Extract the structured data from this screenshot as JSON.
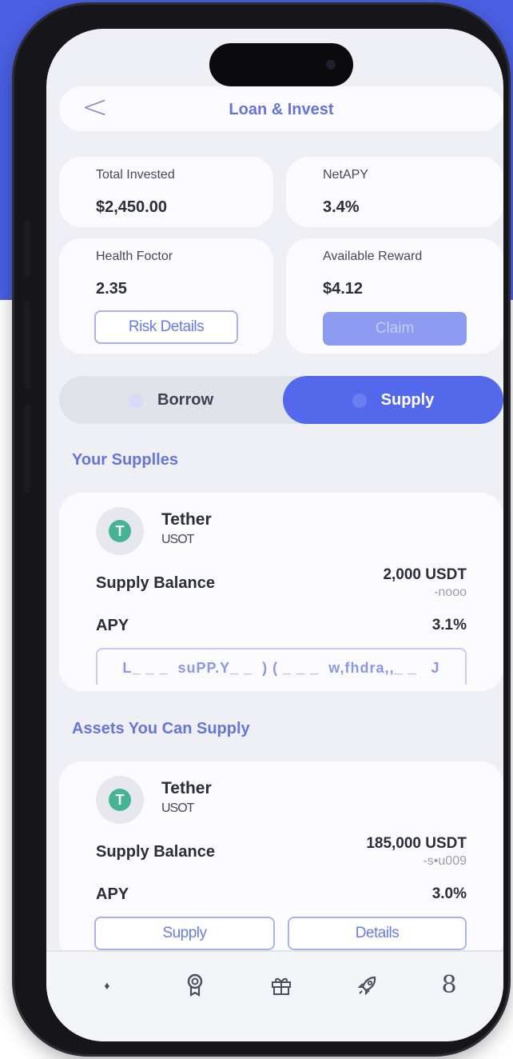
{
  "header": {
    "back_icon": "chevron-left-icon",
    "title": "Loan & Invest"
  },
  "stats": {
    "total_invested": {
      "label": "Total Invested",
      "value": "$2,450.00"
    },
    "net_apy": {
      "label": "NetAPY",
      "value": "3.4%"
    },
    "health_factor": {
      "label": "Health Foctor",
      "value": "2.35",
      "button": "Risk Details"
    },
    "available_reward": {
      "label": "Available Reward",
      "value": "$4.12",
      "button": "Claim"
    }
  },
  "segment": {
    "borrow": "Borrow",
    "supply": "Supply",
    "active": "Supply"
  },
  "your_supplies": {
    "title": "Your Supplles",
    "asset": {
      "name": "Tether",
      "symbol": "USOT",
      "balance_label": "Supply Balance",
      "balance_value": "2,000 USDT",
      "balance_sub": "-nooo",
      "apy_label": "APY",
      "apy_value": "3.1%",
      "actions_text": "L_ _ _  suPP.Y_ _  ) ( _ _ _  w,fhdra,,_ _   J"
    }
  },
  "assets_can_supply": {
    "title": "Assets You Can Supply",
    "asset": {
      "name": "Tether",
      "symbol": "USOT",
      "balance_label": "Supply Balance",
      "balance_value": "185,000 USDT",
      "balance_sub": "-s•u009",
      "apy_label": "APY",
      "apy_value": "3.0%",
      "supply_button": "Supply",
      "details_button": "Details"
    }
  },
  "bottom_nav": {
    "items": [
      {
        "icon": "diamond-icon",
        "glyph": "♦"
      },
      {
        "icon": "award-icon",
        "glyph": ""
      },
      {
        "icon": "gift-icon",
        "glyph": ""
      },
      {
        "icon": "rocket-icon",
        "glyph": ""
      },
      {
        "icon": "profile-icon",
        "glyph": "8"
      }
    ]
  },
  "colors": {
    "brand_blue": "#5468ec",
    "accent_text": "#6674d8",
    "token_green": "#45b493"
  }
}
